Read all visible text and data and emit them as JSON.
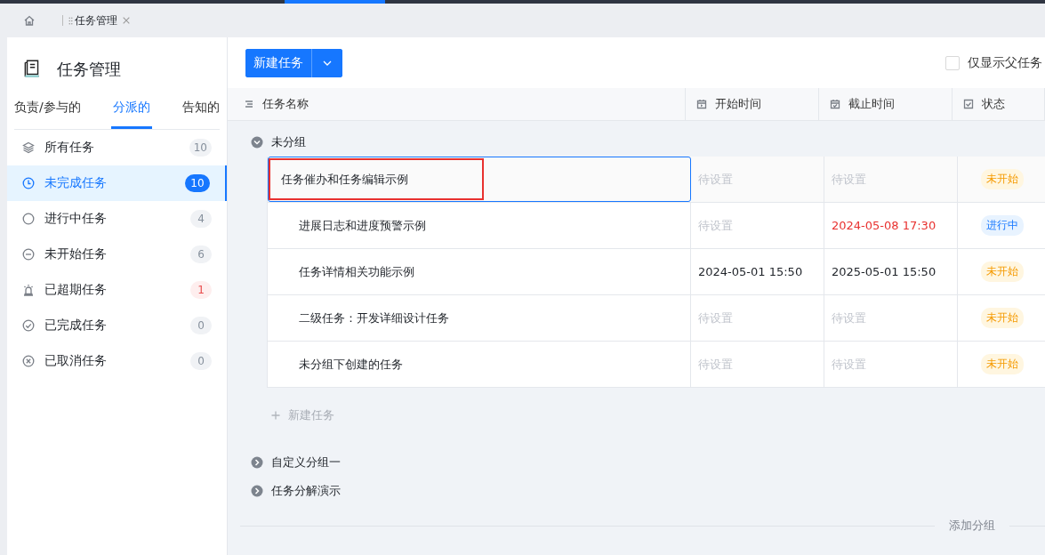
{
  "page_tabs": [
    {
      "label": "任务管理",
      "selected": true
    }
  ],
  "sidebar": {
    "title": "任务管理",
    "tabs": [
      {
        "label": "负责/参与的",
        "selected": false
      },
      {
        "label": "分派的",
        "selected": true
      },
      {
        "label": "告知的",
        "selected": false
      }
    ],
    "items": [
      {
        "kind": "all",
        "label": "所有任务",
        "count": "10",
        "selected": false,
        "alert": false
      },
      {
        "kind": "open",
        "label": "未完成任务",
        "count": "10",
        "selected": true,
        "alert": false
      },
      {
        "kind": "ongoing",
        "label": "进行中任务",
        "count": "4",
        "selected": false,
        "alert": false
      },
      {
        "kind": "waiting",
        "label": "未开始任务",
        "count": "6",
        "selected": false,
        "alert": false
      },
      {
        "kind": "overdue",
        "label": "已超期任务",
        "count": "1",
        "selected": false,
        "alert": true
      },
      {
        "kind": "done",
        "label": "已完成任务",
        "count": "0",
        "selected": false,
        "alert": false
      },
      {
        "kind": "cancelled",
        "label": "已取消任务",
        "count": "0",
        "selected": false,
        "alert": false
      }
    ]
  },
  "toolbar": {
    "new_button": "新建任务",
    "parent_only": {
      "label": "仅显示父任务",
      "checked": false
    }
  },
  "table": {
    "columns": [
      {
        "kind": "name",
        "label": "任务名称"
      },
      {
        "kind": "start",
        "label": "开始时间"
      },
      {
        "kind": "deadline",
        "label": "截止时间"
      },
      {
        "kind": "status",
        "label": "状态"
      }
    ],
    "groups": [
      {
        "name": "未分组",
        "expanded": true,
        "rows": [
          {
            "name": "任务催办和任务编辑示例",
            "selected": true,
            "annotated": true,
            "start": {
              "text": "待设置",
              "unset": true
            },
            "end": {
              "text": "待设置",
              "unset": true,
              "overdue": false
            },
            "status": {
              "text": "未开始",
              "kind": "pending"
            }
          },
          {
            "name": "进展日志和进度预警示例",
            "selected": false,
            "annotated": false,
            "start": {
              "text": "待设置",
              "unset": true
            },
            "end": {
              "text": "2024-05-08 17:30",
              "unset": false,
              "overdue": true
            },
            "status": {
              "text": "进行中",
              "kind": "active"
            }
          },
          {
            "name": "任务详情相关功能示例",
            "selected": false,
            "annotated": false,
            "start": {
              "text": "2024-05-01 15:50",
              "unset": false
            },
            "end": {
              "text": "2025-05-01 15:50",
              "unset": false,
              "overdue": false
            },
            "status": {
              "text": "未开始",
              "kind": "pending"
            }
          },
          {
            "name": "二级任务：开发详细设计任务",
            "selected": false,
            "annotated": false,
            "start": {
              "text": "待设置",
              "unset": true
            },
            "end": {
              "text": "待设置",
              "unset": true,
              "overdue": false
            },
            "status": {
              "text": "未开始",
              "kind": "pending"
            }
          },
          {
            "name": "未分组下创建的任务",
            "selected": false,
            "annotated": false,
            "start": {
              "text": "待设置",
              "unset": true
            },
            "end": {
              "text": "待设置",
              "unset": true,
              "overdue": false
            },
            "status": {
              "text": "未开始",
              "kind": "pending"
            }
          }
        ],
        "add_task": "新建任务"
      },
      {
        "name": "自定义分组一",
        "expanded": false
      },
      {
        "name": "任务分解演示",
        "expanded": false
      }
    ],
    "add_group": "添加分组"
  }
}
